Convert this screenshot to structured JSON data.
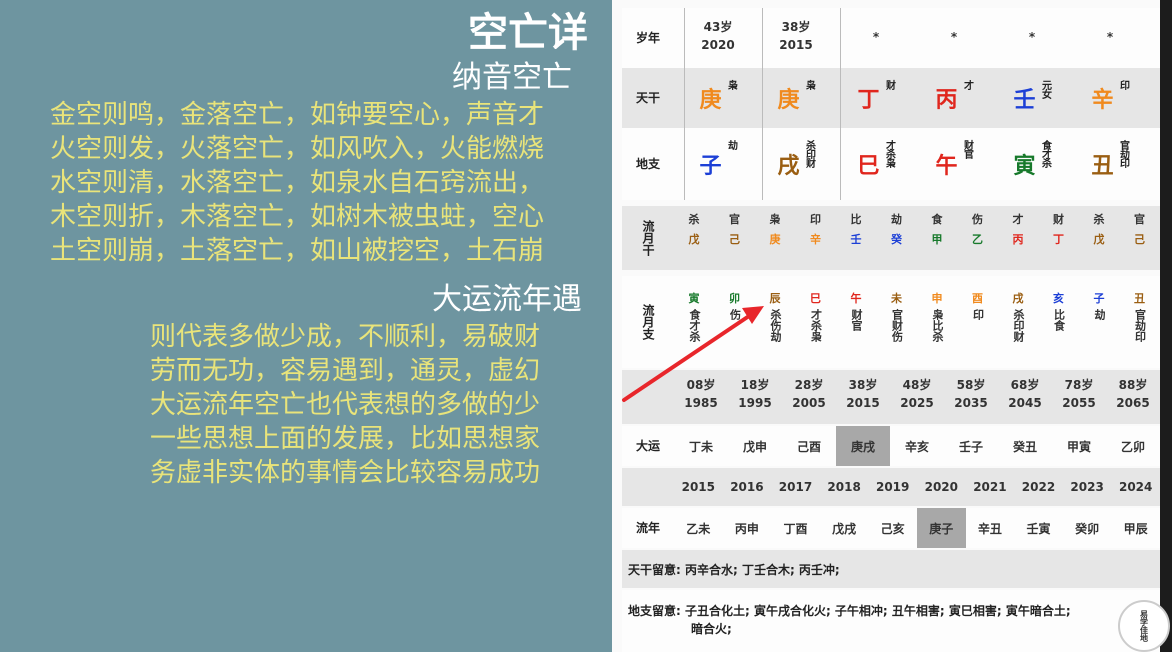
{
  "left": {
    "title": "空亡详",
    "subtitle1": "纳音空亡",
    "lines1": [
      "金空则鸣，金落空亡，如钟要空心，声音才",
      "火空则发，火落空亡，如风吹入，火能燃烧",
      "水空则清，水落空亡，如泉水自石窍流出，",
      "木空则折，木落空亡，如树木被虫蛀，空心",
      "土空则崩，土落空亡，如山被挖空，土石崩"
    ],
    "subtitle2": "大运流年遇",
    "lines2": [
      "则代表多做少成，不顺利，易破财",
      "劳而无功，容易遇到，通灵，虚幻",
      "大运流年空亡也代表想的多做的少",
      "一些思想上面的发展，比如思想家",
      "务虚非实体的事情会比较容易成功"
    ]
  },
  "panel": {
    "sui": {
      "label": "岁年",
      "cells": [
        {
          "age": "43岁",
          "year": "2020"
        },
        {
          "age": "38岁",
          "year": "2015"
        },
        {
          "age": "*",
          "year": ""
        },
        {
          "age": "*",
          "year": ""
        },
        {
          "age": "*",
          "year": ""
        },
        {
          "age": "*",
          "year": ""
        }
      ]
    },
    "tiangan": {
      "label": "天干",
      "cells": [
        {
          "g": "庚",
          "s": "枭",
          "c": "orange"
        },
        {
          "g": "庚",
          "s": "枭",
          "c": "orange"
        },
        {
          "g": "丁",
          "s": "财",
          "c": "red"
        },
        {
          "g": "丙",
          "s": "才",
          "c": "red"
        },
        {
          "g": "壬",
          "s": "元女",
          "c": "blue"
        },
        {
          "g": "辛",
          "s": "印",
          "c": "orange"
        }
      ]
    },
    "dizhi": {
      "label": "地支",
      "cells": [
        {
          "g": "子",
          "s": "劫",
          "c": "blue"
        },
        {
          "g": "戌",
          "s": "杀印财",
          "c": "brown"
        },
        {
          "g": "巳",
          "s": "才杀枭",
          "c": "red"
        },
        {
          "g": "午",
          "s": "财官",
          "c": "red"
        },
        {
          "g": "寅",
          "s": "食才杀",
          "c": "green"
        },
        {
          "g": "丑",
          "s": "官劫印",
          "c": "brown"
        }
      ]
    },
    "liuyuegan": {
      "label": "流月干",
      "cells": [
        {
          "ss": "杀",
          "gz": "戊",
          "c": "brown"
        },
        {
          "ss": "官",
          "gz": "己",
          "c": "brown"
        },
        {
          "ss": "枭",
          "gz": "庚",
          "c": "orange"
        },
        {
          "ss": "印",
          "gz": "辛",
          "c": "orange"
        },
        {
          "ss": "比",
          "gz": "壬",
          "c": "blue"
        },
        {
          "ss": "劫",
          "gz": "癸",
          "c": "blue"
        },
        {
          "ss": "食",
          "gz": "甲",
          "c": "green"
        },
        {
          "ss": "伤",
          "gz": "乙",
          "c": "green"
        },
        {
          "ss": "才",
          "gz": "丙",
          "c": "red"
        },
        {
          "ss": "财",
          "gz": "丁",
          "c": "red"
        },
        {
          "ss": "杀",
          "gz": "戊",
          "c": "brown"
        },
        {
          "ss": "官",
          "gz": "己",
          "c": "brown"
        }
      ]
    },
    "liuyuezhi": {
      "label": "流月支",
      "cells": [
        {
          "gz": "寅",
          "tg": "食才杀",
          "c": "green"
        },
        {
          "gz": "卯",
          "tg": "伤",
          "c": "green"
        },
        {
          "gz": "辰",
          "tg": "杀伤劫",
          "c": "brown"
        },
        {
          "gz": "巳",
          "tg": "才杀枭",
          "c": "red"
        },
        {
          "gz": "午",
          "tg": "财官",
          "c": "red"
        },
        {
          "gz": "未",
          "tg": "官财伤",
          "c": "brown"
        },
        {
          "gz": "申",
          "tg": "枭比杀",
          "c": "orange"
        },
        {
          "gz": "酉",
          "tg": "印",
          "c": "orange"
        },
        {
          "gz": "戌",
          "tg": "杀印财",
          "c": "brown"
        },
        {
          "gz": "亥",
          "tg": "比食",
          "c": "blue"
        },
        {
          "gz": "子",
          "tg": "劫",
          "c": "blue"
        },
        {
          "gz": "丑",
          "tg": "官劫印",
          "c": "brown"
        }
      ]
    },
    "dayun_ages": [
      {
        "age": "08岁",
        "year": "1985"
      },
      {
        "age": "18岁",
        "year": "1995"
      },
      {
        "age": "28岁",
        "year": "2005"
      },
      {
        "age": "38岁",
        "year": "2015"
      },
      {
        "age": "48岁",
        "year": "2025"
      },
      {
        "age": "58岁",
        "year": "2035"
      },
      {
        "age": "68岁",
        "year": "2045"
      },
      {
        "age": "78岁",
        "year": "2055"
      },
      {
        "age": "88岁",
        "year": "2065"
      }
    ],
    "dayun": {
      "label": "大运",
      "items": [
        "丁未",
        "戊申",
        "己酉",
        "庚戌",
        "辛亥",
        "壬子",
        "癸丑",
        "甲寅",
        "乙卯"
      ],
      "selected_index": 3
    },
    "liunian_years": [
      "2015",
      "2016",
      "2017",
      "2018",
      "2019",
      "2020",
      "2021",
      "2022",
      "2023",
      "2024"
    ],
    "liunian": {
      "label": "流年",
      "items": [
        "乙未",
        "丙申",
        "丁酉",
        "戊戌",
        "己亥",
        "庚子",
        "辛丑",
        "壬寅",
        "癸卯",
        "甲辰"
      ],
      "selected_index": 5
    },
    "tiangan_note": "天干留意: 丙辛合水; 丁壬合木; 丙壬冲;",
    "dizhi_note_1": "地支留意: 子丑合化土; 寅午戌合化火; 子午相冲; 丑午相害; 寅巳相害; 寅午暗合土;",
    "dizhi_note_2": "暗合火;"
  },
  "logo_text": "易学佳地",
  "colors": {
    "red": "#e0261d",
    "orange": "#f08a1e",
    "blue": "#1c3fd6",
    "green": "#17792b",
    "brown": "#9a5e12",
    "left_bg": "#6e95a0",
    "left_text": "#e9e47a",
    "arrow": "#e8262b"
  }
}
